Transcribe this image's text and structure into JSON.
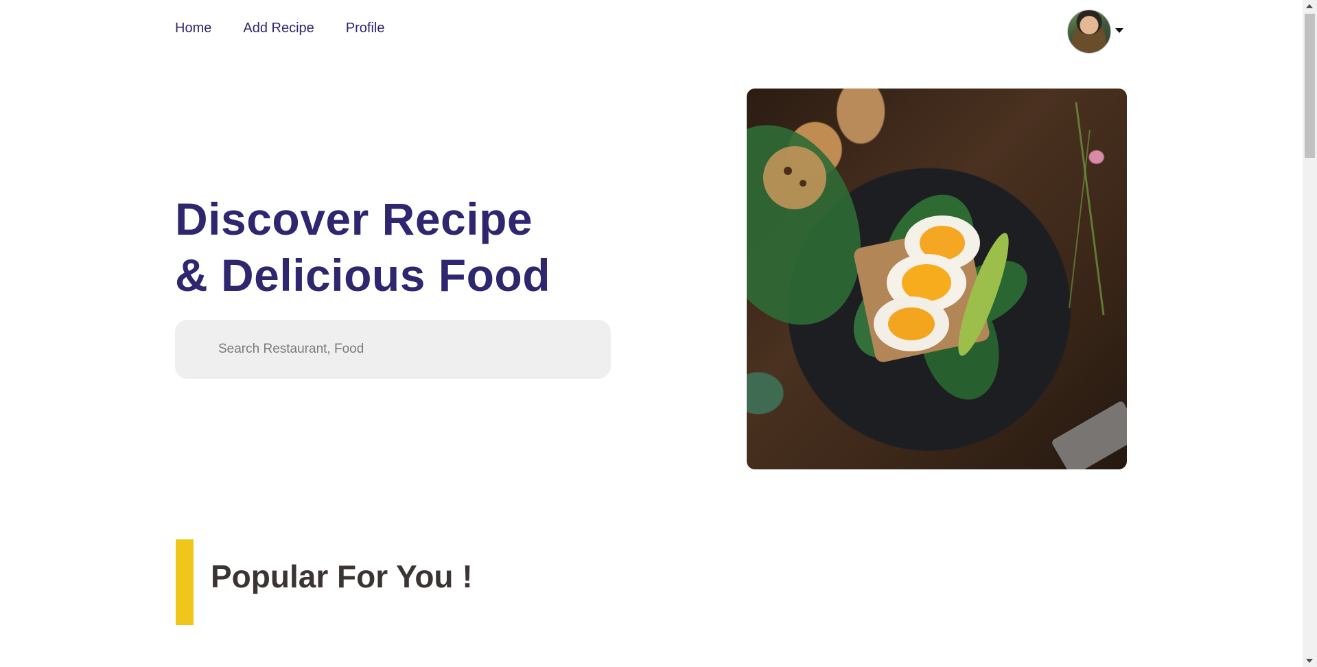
{
  "nav": {
    "items": [
      {
        "label": "Home"
      },
      {
        "label": "Add Recipe"
      },
      {
        "label": "Profile"
      }
    ]
  },
  "hero": {
    "title_line1": "Discover Recipe",
    "title_line2": "& Delicious Food",
    "search_placeholder": "Search Restaurant, Food"
  },
  "section": {
    "title": "Popular For You !"
  },
  "colors": {
    "primary": "#2e266f",
    "accent": "#efc619",
    "search_bg": "#efefef",
    "heading_dark": "#3b3433"
  },
  "icons": {
    "avatar": "user-avatar",
    "dropdown": "caret-down-icon"
  }
}
